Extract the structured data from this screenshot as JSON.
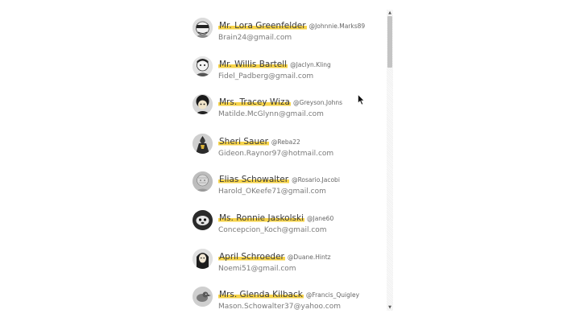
{
  "users": [
    {
      "name": "Mr. Lora Greenfelder",
      "handle": "@Johnnie.Marks89",
      "email": "Brain24@gmail.com",
      "avatar_icon": "avatar-masked-face-icon"
    },
    {
      "name": "Mr. Willis Bartell",
      "handle": "@Jaclyn.Kling",
      "email": "Fidel_Padberg@gmail.com",
      "avatar_icon": "avatar-face-icon"
    },
    {
      "name": "Mrs. Tracey Wiza",
      "handle": "@Greyson.Johns",
      "email": "Matilde.McGlynn@gmail.com",
      "avatar_icon": "avatar-curly-hair-icon"
    },
    {
      "name": "Sheri Sauer",
      "handle": "@Reba22",
      "email": "Gideon.Raynor97@hotmail.com",
      "avatar_icon": "avatar-caped-figure-icon"
    },
    {
      "name": "Elias Schowalter",
      "handle": "@Rosario.Jacobi",
      "email": "Harold_OKeefe71@gmail.com",
      "avatar_icon": "avatar-sketch-face-icon"
    },
    {
      "name": "Ms. Ronnie Jaskolski",
      "handle": "@Jane60",
      "email": "Concepcion_Koch@gmail.com",
      "avatar_icon": "avatar-animal-icon"
    },
    {
      "name": "April Schroeder",
      "handle": "@Duane.Hintz",
      "email": "Noemi51@gmail.com",
      "avatar_icon": "avatar-long-hair-icon"
    },
    {
      "name": "Mrs. Glenda Kilback",
      "handle": "@Francis_Quigley",
      "email": "Mason.Schowalter37@yahoo.com",
      "avatar_icon": "avatar-bird-icon"
    }
  ],
  "scrollbar": {
    "position_fraction": 0.0,
    "visible_fraction": 0.18,
    "up_arrow": "▲",
    "down_arrow": "▼"
  },
  "colors": {
    "name_highlight": "#f7d44a",
    "name_text": "#3a3a3a",
    "email_text": "#7a7a7a",
    "handle_text": "#666666"
  }
}
